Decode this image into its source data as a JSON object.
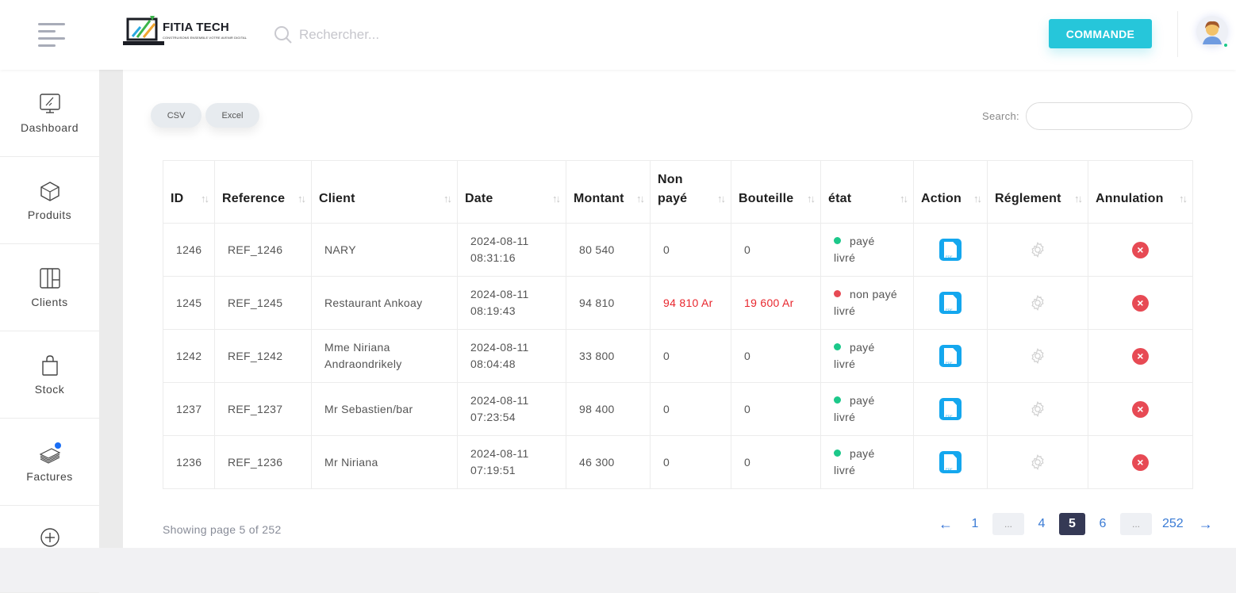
{
  "header": {
    "logo_name": "FITIA TECH",
    "logo_tagline": "CONSTRUISONS ENSEMBLE VOTRE AVENIR DIGITAL",
    "search_placeholder": "Rechercher...",
    "command_button": "COMMANDE"
  },
  "sidebar": {
    "items": [
      {
        "label": "Dashboard",
        "icon": "monitor-icon"
      },
      {
        "label": "Produits",
        "icon": "box-icon"
      },
      {
        "label": "Clients",
        "icon": "layout-icon"
      },
      {
        "label": "Stock",
        "icon": "shopping-bag-icon"
      },
      {
        "label": "Factures",
        "icon": "money-stack-icon",
        "badge": true
      },
      {
        "label": "",
        "icon": "plus-circle-icon"
      }
    ]
  },
  "toolbar": {
    "csv_label": "CSV",
    "excel_label": "Excel",
    "search_label": "Search:",
    "search_value": ""
  },
  "table": {
    "columns": [
      "ID",
      "Reference",
      "Client",
      "Date",
      "Montant",
      "Non payé",
      "Bouteille",
      "état",
      "Action",
      "Réglement",
      "Annulation"
    ],
    "sort_icon": "↑↓",
    "rows": [
      {
        "id": "1246",
        "reference": "REF_1246",
        "client": "NARY",
        "date": "2024-08-11",
        "time": "08:31:16",
        "montant": "80 540",
        "non_paye": "0",
        "bouteille": "0",
        "status": "payé",
        "status_color": "#1cc88a",
        "delivery": "livré",
        "highlight": false
      },
      {
        "id": "1245",
        "reference": "REF_1245",
        "client": "Restaurant Ankoay",
        "date": "2024-08-11",
        "time": "08:19:43",
        "montant": "94 810",
        "non_paye": "94 810 Ar",
        "bouteille": "19 600 Ar",
        "status": "non payé",
        "status_color": "#e74a54",
        "delivery": "livré",
        "highlight": true
      },
      {
        "id": "1242",
        "reference": "REF_1242",
        "client": "Mme Niriana Andraondrikely",
        "date": "2024-08-11",
        "time": "08:04:48",
        "montant": "33 800",
        "non_paye": "0",
        "bouteille": "0",
        "status": "payé",
        "status_color": "#1cc88a",
        "delivery": "livré",
        "highlight": false
      },
      {
        "id": "1237",
        "reference": "REF_1237",
        "client": "Mr Sebastien/bar",
        "date": "2024-08-11",
        "time": "07:23:54",
        "montant": "98 400",
        "non_paye": "0",
        "bouteille": "0",
        "status": "payé",
        "status_color": "#1cc88a",
        "delivery": "livré",
        "highlight": false
      },
      {
        "id": "1236",
        "reference": "REF_1236",
        "client": "Mr Niriana",
        "date": "2024-08-11",
        "time": "07:19:51",
        "montant": "46 300",
        "non_paye": "0",
        "bouteille": "0",
        "status": "payé",
        "status_color": "#1cc88a",
        "delivery": "livré",
        "highlight": false
      }
    ],
    "action_icon_text": "PDF",
    "cancel_icon": "×"
  },
  "pagination": {
    "showing": "Showing page 5 of 252",
    "prev": "←",
    "next": "→",
    "pages": [
      "1",
      "...",
      "4",
      "5",
      "6",
      "...",
      "252"
    ],
    "current": "5"
  },
  "colors": {
    "accent": "#26c6da",
    "paid": "#1cc88a",
    "unpaid": "#e74a54",
    "pdf": "#14a7ee",
    "active_page": "#353955"
  }
}
